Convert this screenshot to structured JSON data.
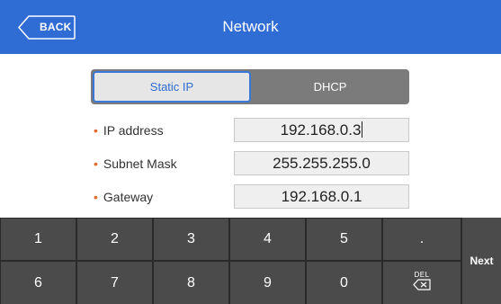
{
  "header": {
    "back_label": "BACK",
    "title": "Network"
  },
  "segment": {
    "static_label": "Static IP",
    "dhcp_label": "DHCP"
  },
  "form": {
    "ip_label": "IP address",
    "ip_value": "192.168.0.3",
    "subnet_label": "Subnet Mask",
    "subnet_value": "255.255.255.0",
    "gateway_label": "Gateway",
    "gateway_value": "192.168.0.1"
  },
  "keyboard": {
    "row1": [
      "1",
      "2",
      "3",
      "4",
      "5",
      "."
    ],
    "row2": [
      "6",
      "7",
      "8",
      "9",
      "0"
    ],
    "del_label": "DEL",
    "next_label": "Next"
  },
  "colors": {
    "header": "#2f6cd4",
    "accent": "#3a78d8",
    "bullet": "#e46a2c",
    "key": "#4b4b4b"
  }
}
